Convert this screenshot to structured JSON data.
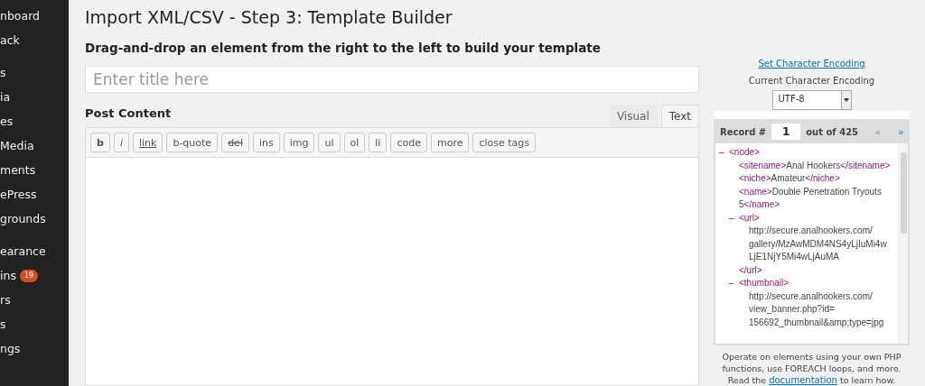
{
  "sidebar": {
    "groups": [
      [
        {
          "label": "nboard"
        },
        {
          "label": "ack"
        }
      ],
      [
        {
          "label": "s"
        },
        {
          "label": "ia"
        },
        {
          "label": "es"
        },
        {
          "label": "Media"
        },
        {
          "label": "ments"
        },
        {
          "label": "ePress"
        },
        {
          "label": "grounds"
        }
      ],
      [
        {
          "label": "earance"
        },
        {
          "label": "ins",
          "badge": "19"
        },
        {
          "label": "rs"
        },
        {
          "label": "s"
        },
        {
          "label": "ngs"
        }
      ]
    ]
  },
  "page": {
    "title": "Import XML/CSV - Step 3: Template Builder",
    "subtitle": "Drag-and-drop an element from the right to the left to build your template"
  },
  "title_field": {
    "placeholder": "Enter title here"
  },
  "editor": {
    "label": "Post Content",
    "tabs": [
      {
        "label": "Visual",
        "selected": false
      },
      {
        "label": "Text",
        "selected": true
      }
    ],
    "toolbar": [
      {
        "label": "b",
        "kind": "bold"
      },
      {
        "label": "i",
        "kind": "italic"
      },
      {
        "label": "link",
        "kind": "link"
      },
      {
        "label": "b-quote",
        "kind": "plain"
      },
      {
        "label": "del",
        "kind": "strike"
      },
      {
        "label": "ins",
        "kind": "plain"
      },
      {
        "label": "img",
        "kind": "plain"
      },
      {
        "label": "ul",
        "kind": "plain"
      },
      {
        "label": "ol",
        "kind": "plain"
      },
      {
        "label": "li",
        "kind": "plain"
      },
      {
        "label": "code",
        "kind": "plain"
      },
      {
        "label": "more",
        "kind": "plain"
      },
      {
        "label": "close tags",
        "kind": "plain"
      }
    ]
  },
  "encoding": {
    "link": "Set Character Encoding",
    "label": "Current Character Encoding",
    "value": "UTF-8"
  },
  "records": {
    "label": "Record #",
    "current": "1",
    "total": "out of 425",
    "prev": "«",
    "next": "»"
  },
  "tree": [
    {
      "kind": "element",
      "toggle": "–",
      "open": "<node>",
      "children": [
        {
          "kind": "leaf",
          "open": "<sitename>",
          "text": "Anal Hookers",
          "close": "</sitename>"
        },
        {
          "kind": "leaf",
          "open": "<niche>",
          "text": "Amateur",
          "close": "</niche>"
        },
        {
          "kind": "leaf",
          "open": "<name>",
          "text": "Double Penetration Tryouts 5",
          "close": "</name>"
        },
        {
          "kind": "element",
          "toggle": "–",
          "open": "<url>",
          "text": "http://secure.analhookers.com/ gallery/MzAwMDM4NS4yLjIuMi4w LjE1NjY5Mi4wLjAuMA",
          "close": "</url>"
        },
        {
          "kind": "element",
          "toggle": "–",
          "open": "<thumbnail>",
          "text": "http://secure.analhookers.com/ view_banner.php?id= 156692_thumbnail&amp;type=jpg"
        }
      ]
    }
  ],
  "footer": {
    "before": "Operate on elements using your own PHP functions, use FOREACH loops, and more. Read the",
    "link": "documentation",
    "after": "to learn how."
  }
}
